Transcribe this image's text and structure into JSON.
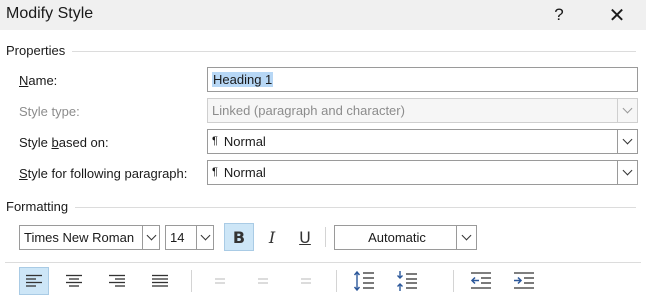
{
  "dialog": {
    "title": "Modify Style",
    "help_glyph": "?",
    "close_glyph": "✕"
  },
  "properties": {
    "heading": "Properties",
    "name": {
      "label_pre": "",
      "label_u": "N",
      "label_post": "ame:",
      "value": "Heading 1"
    },
    "style_type": {
      "label": "Style type:",
      "value": "Linked (paragraph and character)"
    },
    "based_on": {
      "label_pre": "Style ",
      "label_u": "b",
      "label_post": "ased on:",
      "value": "Normal",
      "icon": "pilcrow-icon"
    },
    "following": {
      "label_pre": "",
      "label_u": "S",
      "label_post": "tyle for following paragraph:",
      "value": "Normal",
      "icon": "pilcrow-icon"
    },
    "pilcrow": "¶"
  },
  "formatting": {
    "heading": "Formatting",
    "font": "Times New Roman",
    "size": "14",
    "bold": "B",
    "italic": "I",
    "underline": "U",
    "color": "Automatic",
    "bold_active": true,
    "alignment": [
      "align-left-icon",
      "align-center-icon",
      "align-right-icon",
      "justify-icon",
      "distributed-1-icon",
      "distributed-2-icon",
      "distributed-3-icon",
      "increase-line-spacing-icon",
      "decrease-line-spacing-icon",
      "decrease-indent-icon",
      "increase-indent-icon"
    ],
    "active_alignment": "align-left-icon",
    "accent": "#cde6f7"
  }
}
